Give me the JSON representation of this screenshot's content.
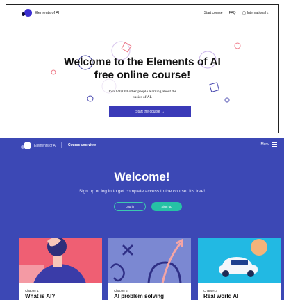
{
  "landing": {
    "logo_text": "Elements of AI",
    "nav": {
      "start_course": "Start course",
      "faq": "FAQ",
      "language": "International"
    },
    "title_line1": "Welcome to the Elements of AI",
    "title_line2": "free online course!",
    "subtitle_line1": "Join 140,000 other people learning about the",
    "subtitle_line2": "basics of AI.",
    "start_button": "Start the course →"
  },
  "overview": {
    "logo_text": "Elements of AI",
    "course_overview": "Course overview",
    "menu_label": "Menu",
    "welcome": "Welcome!",
    "signup_text": "Sign up or log in to get complete access to the course. It's free!",
    "login_button": "Log in",
    "signup_button": "Sign up",
    "cards": [
      {
        "chapter": "Chapter 1",
        "title": "What is AI?"
      },
      {
        "chapter": "Chapter 2",
        "title": "AI problem solving"
      },
      {
        "chapter": "Chapter 3",
        "title": "Real world AI"
      }
    ],
    "colors": {
      "background": "#3c48b5",
      "accent": "#26c2a5",
      "card1": "#ef5f73",
      "card2": "#7b88d2",
      "card3": "#22b9e3"
    }
  }
}
